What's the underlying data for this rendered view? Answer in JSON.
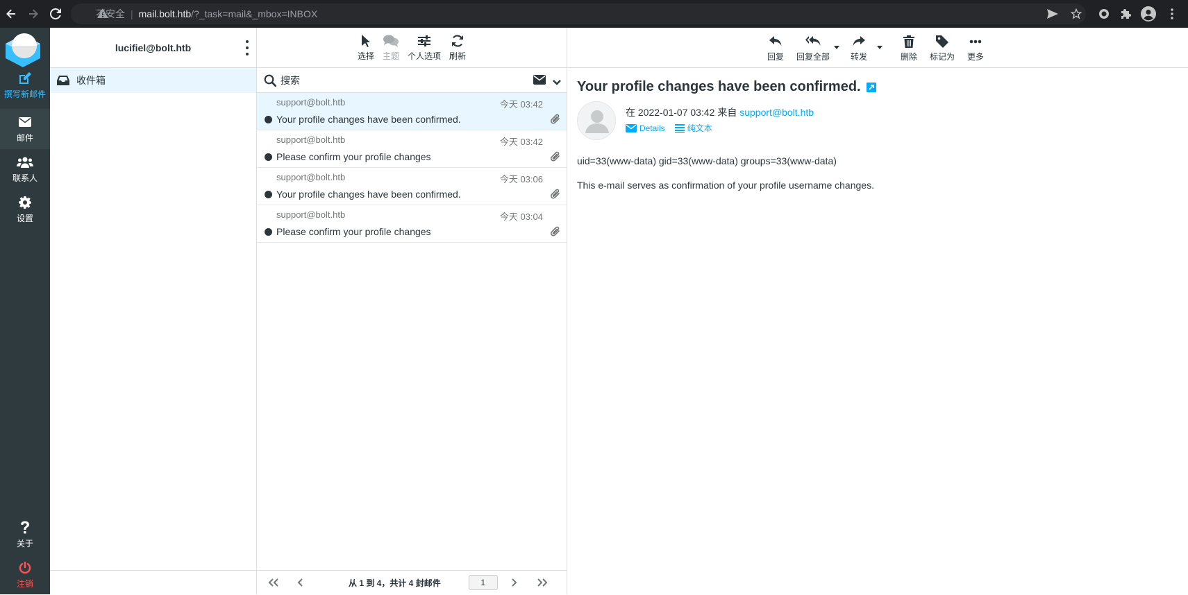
{
  "browser": {
    "security_label": "不安全",
    "url_host": "mail.bolt.htb",
    "url_path": "/?_task=mail&_mbox=INBOX"
  },
  "appnav": {
    "compose": "撰写新邮件",
    "mail": "邮件",
    "contacts": "联系人",
    "settings": "设置",
    "about": "关于",
    "logout": "注销"
  },
  "account": {
    "email": "lucifiel@bolt.htb"
  },
  "folders": [
    {
      "label": "收件箱"
    }
  ],
  "list_toolbar": {
    "select": "选择",
    "threads": "主题",
    "options": "个人选项",
    "refresh": "刷新"
  },
  "search": {
    "placeholder": "搜索"
  },
  "messages": [
    {
      "from": "support@bolt.htb",
      "date": "今天 03:42",
      "subject": "Your profile changes have been confirmed."
    },
    {
      "from": "support@bolt.htb",
      "date": "今天 03:42",
      "subject": "Please confirm your profile changes"
    },
    {
      "from": "support@bolt.htb",
      "date": "今天 03:06",
      "subject": "Your profile changes have been confirmed."
    },
    {
      "from": "support@bolt.htb",
      "date": "今天 03:04",
      "subject": "Please confirm your profile changes"
    }
  ],
  "pager": {
    "info": "从 1 到 4，共计 4 封邮件",
    "page": "1"
  },
  "preview_toolbar": {
    "reply": "回复",
    "reply_all": "回复全部",
    "forward": "转发",
    "delete": "删除",
    "mark": "标记为",
    "more": "更多"
  },
  "preview": {
    "subject": "Your profile changes have been confirmed.",
    "date_prefix": "在 2022-01-07 03:42 来自",
    "sender": "support@bolt.htb",
    "details": "Details",
    "plaintext": "纯文本",
    "body_line1": "uid=33(www-data) gid=33(www-data) groups=33(www-data)",
    "body_line2": "This e-mail serves as confirmation of your profile username changes."
  },
  "colors": {
    "nav_bg": "#2f3a3f",
    "accent": "#00acff",
    "selected_row": "#e8f6ff",
    "logout": "#ff5552"
  }
}
